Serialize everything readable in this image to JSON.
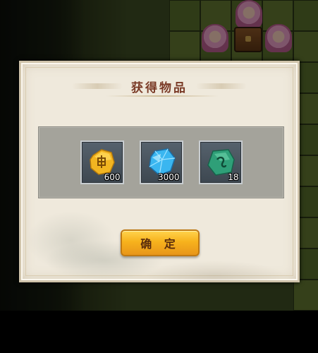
{
  "dialog": {
    "title": "获得物品",
    "items": [
      {
        "icon": "gold-ore-icon",
        "quantity": "600"
      },
      {
        "icon": "blue-crystal-icon",
        "quantity": "3000"
      },
      {
        "icon": "jade-stone-icon",
        "quantity": "18"
      }
    ],
    "confirm_label": "确 定"
  },
  "colors": {
    "title": "#7a3a26",
    "button_gold": "#f7b21c",
    "panel_gray": "#a4a39b"
  }
}
